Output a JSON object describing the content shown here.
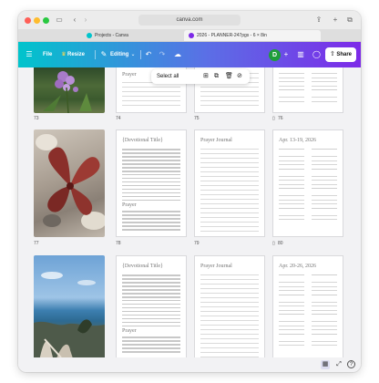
{
  "browser": {
    "url": "canva.com",
    "tabs": [
      {
        "label": "Projects - Canva"
      },
      {
        "label": "2026 - PLANNER-247pgs - 6 × 8in"
      }
    ]
  },
  "header": {
    "file_label": "File",
    "resize_label": "Resize",
    "editing_label": "Editing",
    "avatar_initial": "D",
    "share_label": "Share",
    "accent_colors": [
      "#00c4cc",
      "#7d2ae8"
    ]
  },
  "selection_toolbar": {
    "select_all_label": "Select all"
  },
  "pages": {
    "row1": {
      "n1": "73",
      "n2": "74",
      "n3": "75",
      "n4": "76",
      "t2": "Prayer"
    },
    "row2": {
      "n1": "77",
      "n2": "78",
      "n3": "79",
      "n4": "80",
      "t2": "{Devotional Title}",
      "t2b": "Prayer",
      "t3": "Prayer Journal",
      "t4": "Apr. 13-19, 2026"
    },
    "row3": {
      "t2": "{Devotional Title}",
      "t2b": "Prayer",
      "t3": "Prayer Journal",
      "t4": "Apr. 20-26, 2026"
    }
  },
  "icons": [
    "sidebar-icon",
    "back-icon",
    "forward-icon",
    "share-icon",
    "new-tab-icon",
    "tabs-icon",
    "menu-icon",
    "crown-icon",
    "pencil-icon",
    "undo-icon",
    "redo-icon",
    "cloud-icon",
    "plus-icon",
    "chart-icon",
    "comment-icon",
    "grid-view-icon",
    "expand-icon",
    "help-icon"
  ]
}
